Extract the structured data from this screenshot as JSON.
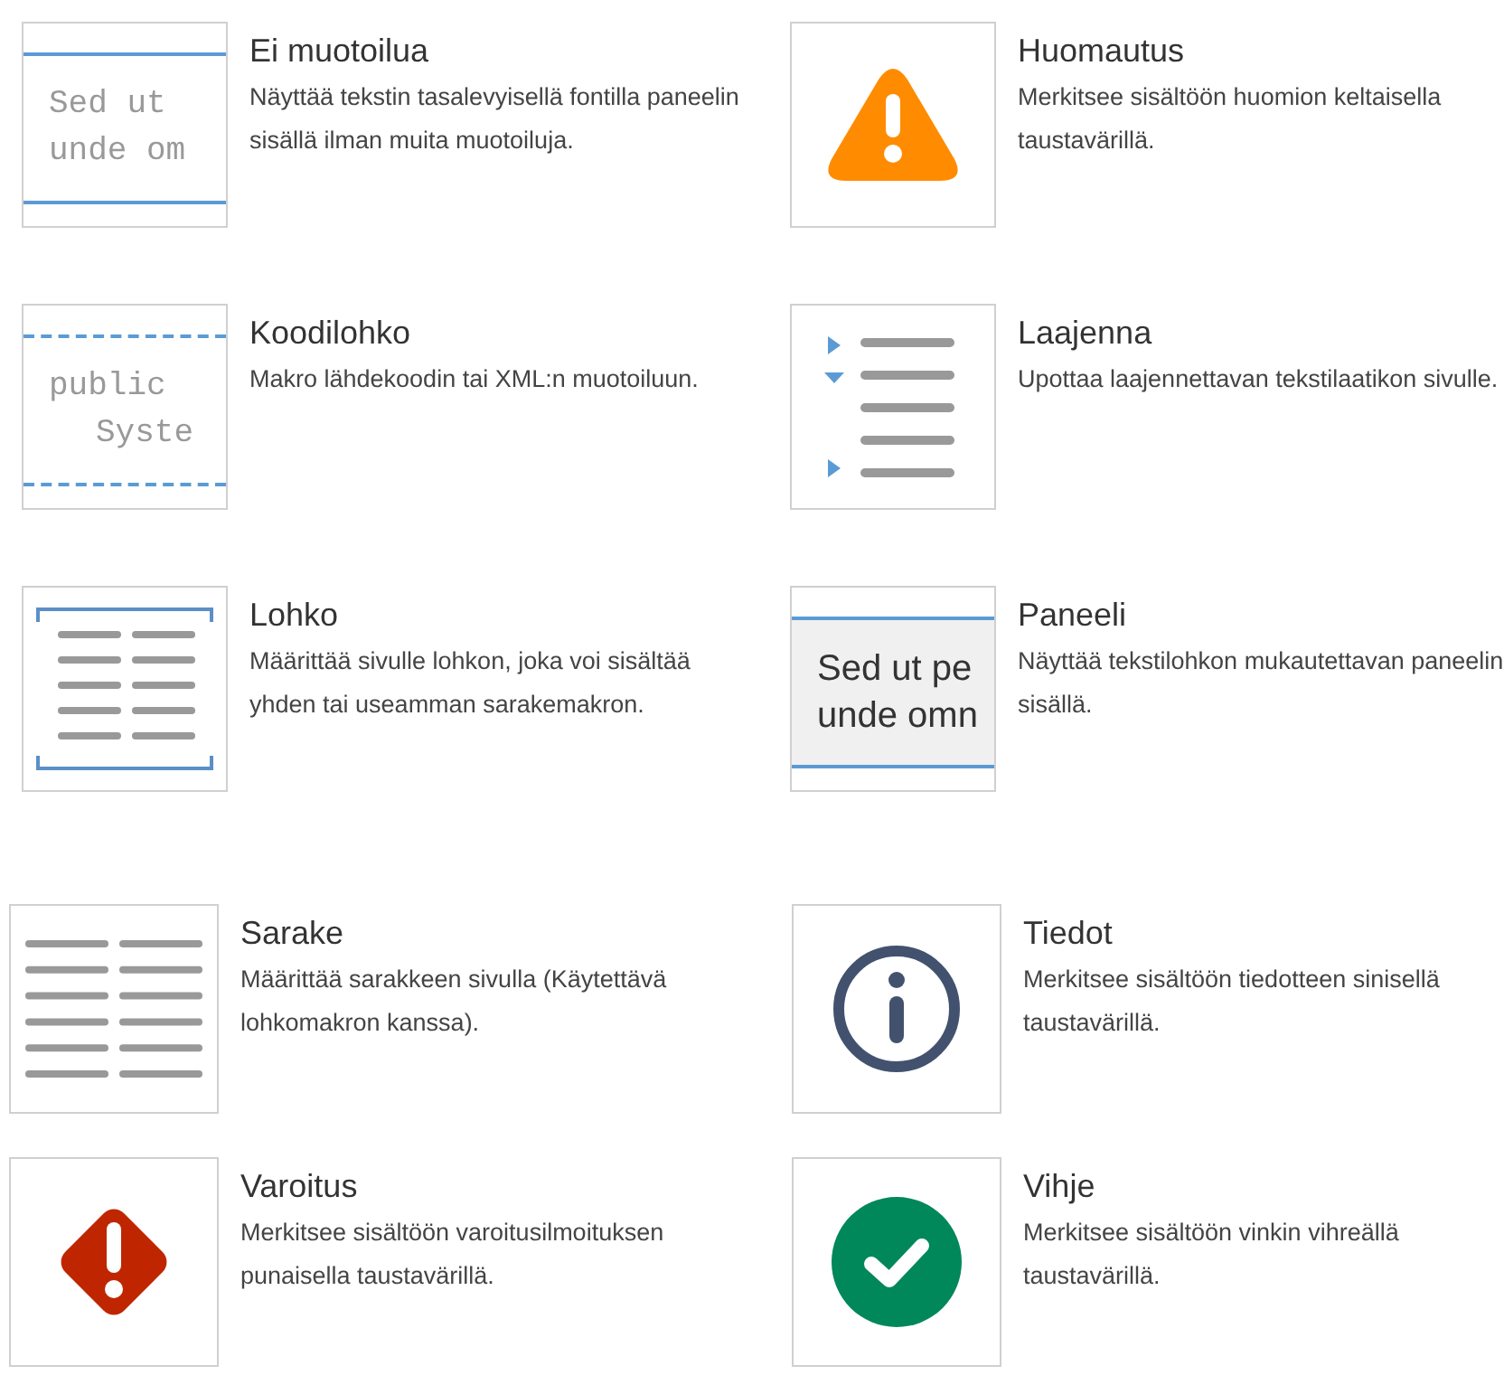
{
  "macros": [
    {
      "kind": "mono-text",
      "title": "Ei muotoilua",
      "description": "Näyttää tekstin tasalevyisellä fontilla paneelin sisällä ilman muita muotoiluja.",
      "preview_lines": [
        "Sed ut",
        "unde om"
      ]
    },
    {
      "kind": "note",
      "title": "Huomautus",
      "description": "Merkitsee sisältöön huomion keltaisella taustavärillä."
    },
    {
      "kind": "code",
      "title": "Koodilohko",
      "description": "Makro lähdekoodin tai XML:n muotoiluun.",
      "preview_lines": [
        "public",
        "Syste"
      ]
    },
    {
      "kind": "expand",
      "title": "Laajenna",
      "description": "Upottaa laajennettavan tekstilaatikon sivulle."
    },
    {
      "kind": "section",
      "title": "Lohko",
      "description": "Määrittää sivulle lohkon, joka voi sisältää yhden tai useamman sarakemakron."
    },
    {
      "kind": "panel",
      "title": "Paneeli",
      "description": "Näyttää tekstilohkon mukautettavan paneelin sisällä.",
      "preview_lines": [
        "Sed ut pe",
        "unde omn"
      ]
    },
    {
      "kind": "column",
      "title": "Sarake",
      "description": "Määrittää sarakkeen sivulla (Käytettävä lohkomakron kanssa)."
    },
    {
      "kind": "info",
      "title": "Tiedot",
      "description": "Merkitsee sisältöön tiedotteen sinisellä taustavärillä."
    },
    {
      "kind": "warning",
      "title": "Varoitus",
      "description": "Merkitsee sisältöön varoitusilmoituksen punaisella taustavärillä."
    },
    {
      "kind": "tip",
      "title": "Vihje",
      "description": "Merkitsee sisältöön vinkin vihreällä taustavärillä."
    }
  ]
}
